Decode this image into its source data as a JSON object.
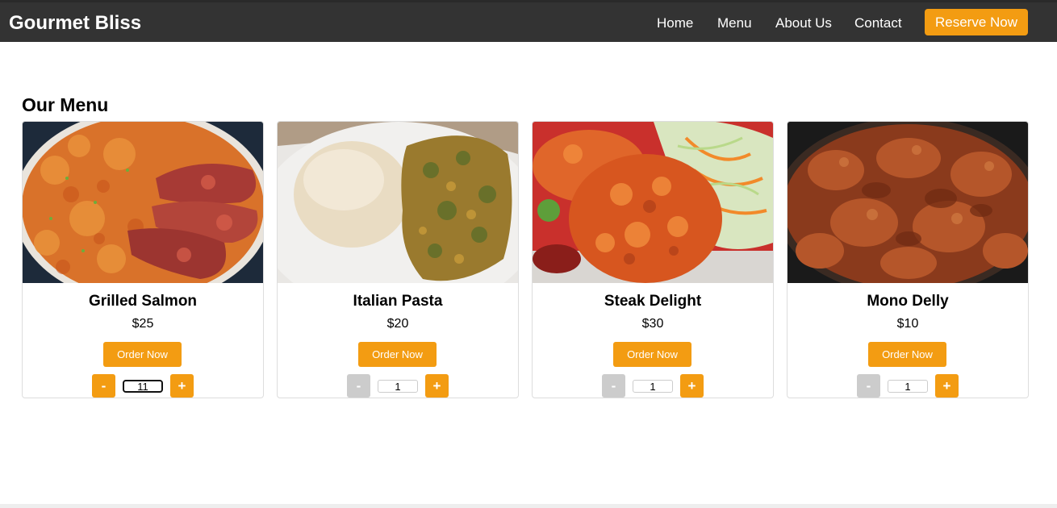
{
  "navbar": {
    "brand": "Gourmet Bliss",
    "links": [
      "Home",
      "Menu",
      "About Us",
      "Contact"
    ],
    "reserve_label": "Reserve Now"
  },
  "menu_section": {
    "title": "Our Menu"
  },
  "cards": [
    {
      "name": "Grilled Salmon",
      "price": "$25",
      "order_label": "Order Now",
      "minus": "-",
      "plus": "+",
      "quantity": "11"
    },
    {
      "name": "Italian Pasta",
      "price": "$20",
      "order_label": "Order Now",
      "minus": "-",
      "plus": "+",
      "quantity": "1"
    },
    {
      "name": "Steak Delight",
      "price": "$30",
      "order_label": "Order Now",
      "minus": "-",
      "plus": "+",
      "quantity": "1"
    },
    {
      "name": "Mono Delly",
      "price": "$10",
      "order_label": "Order Now",
      "minus": "-",
      "plus": "+",
      "quantity": "1"
    }
  ],
  "colors": {
    "navbar": "#333333",
    "accent": "#f39c12",
    "disabled": "#cccccc"
  }
}
